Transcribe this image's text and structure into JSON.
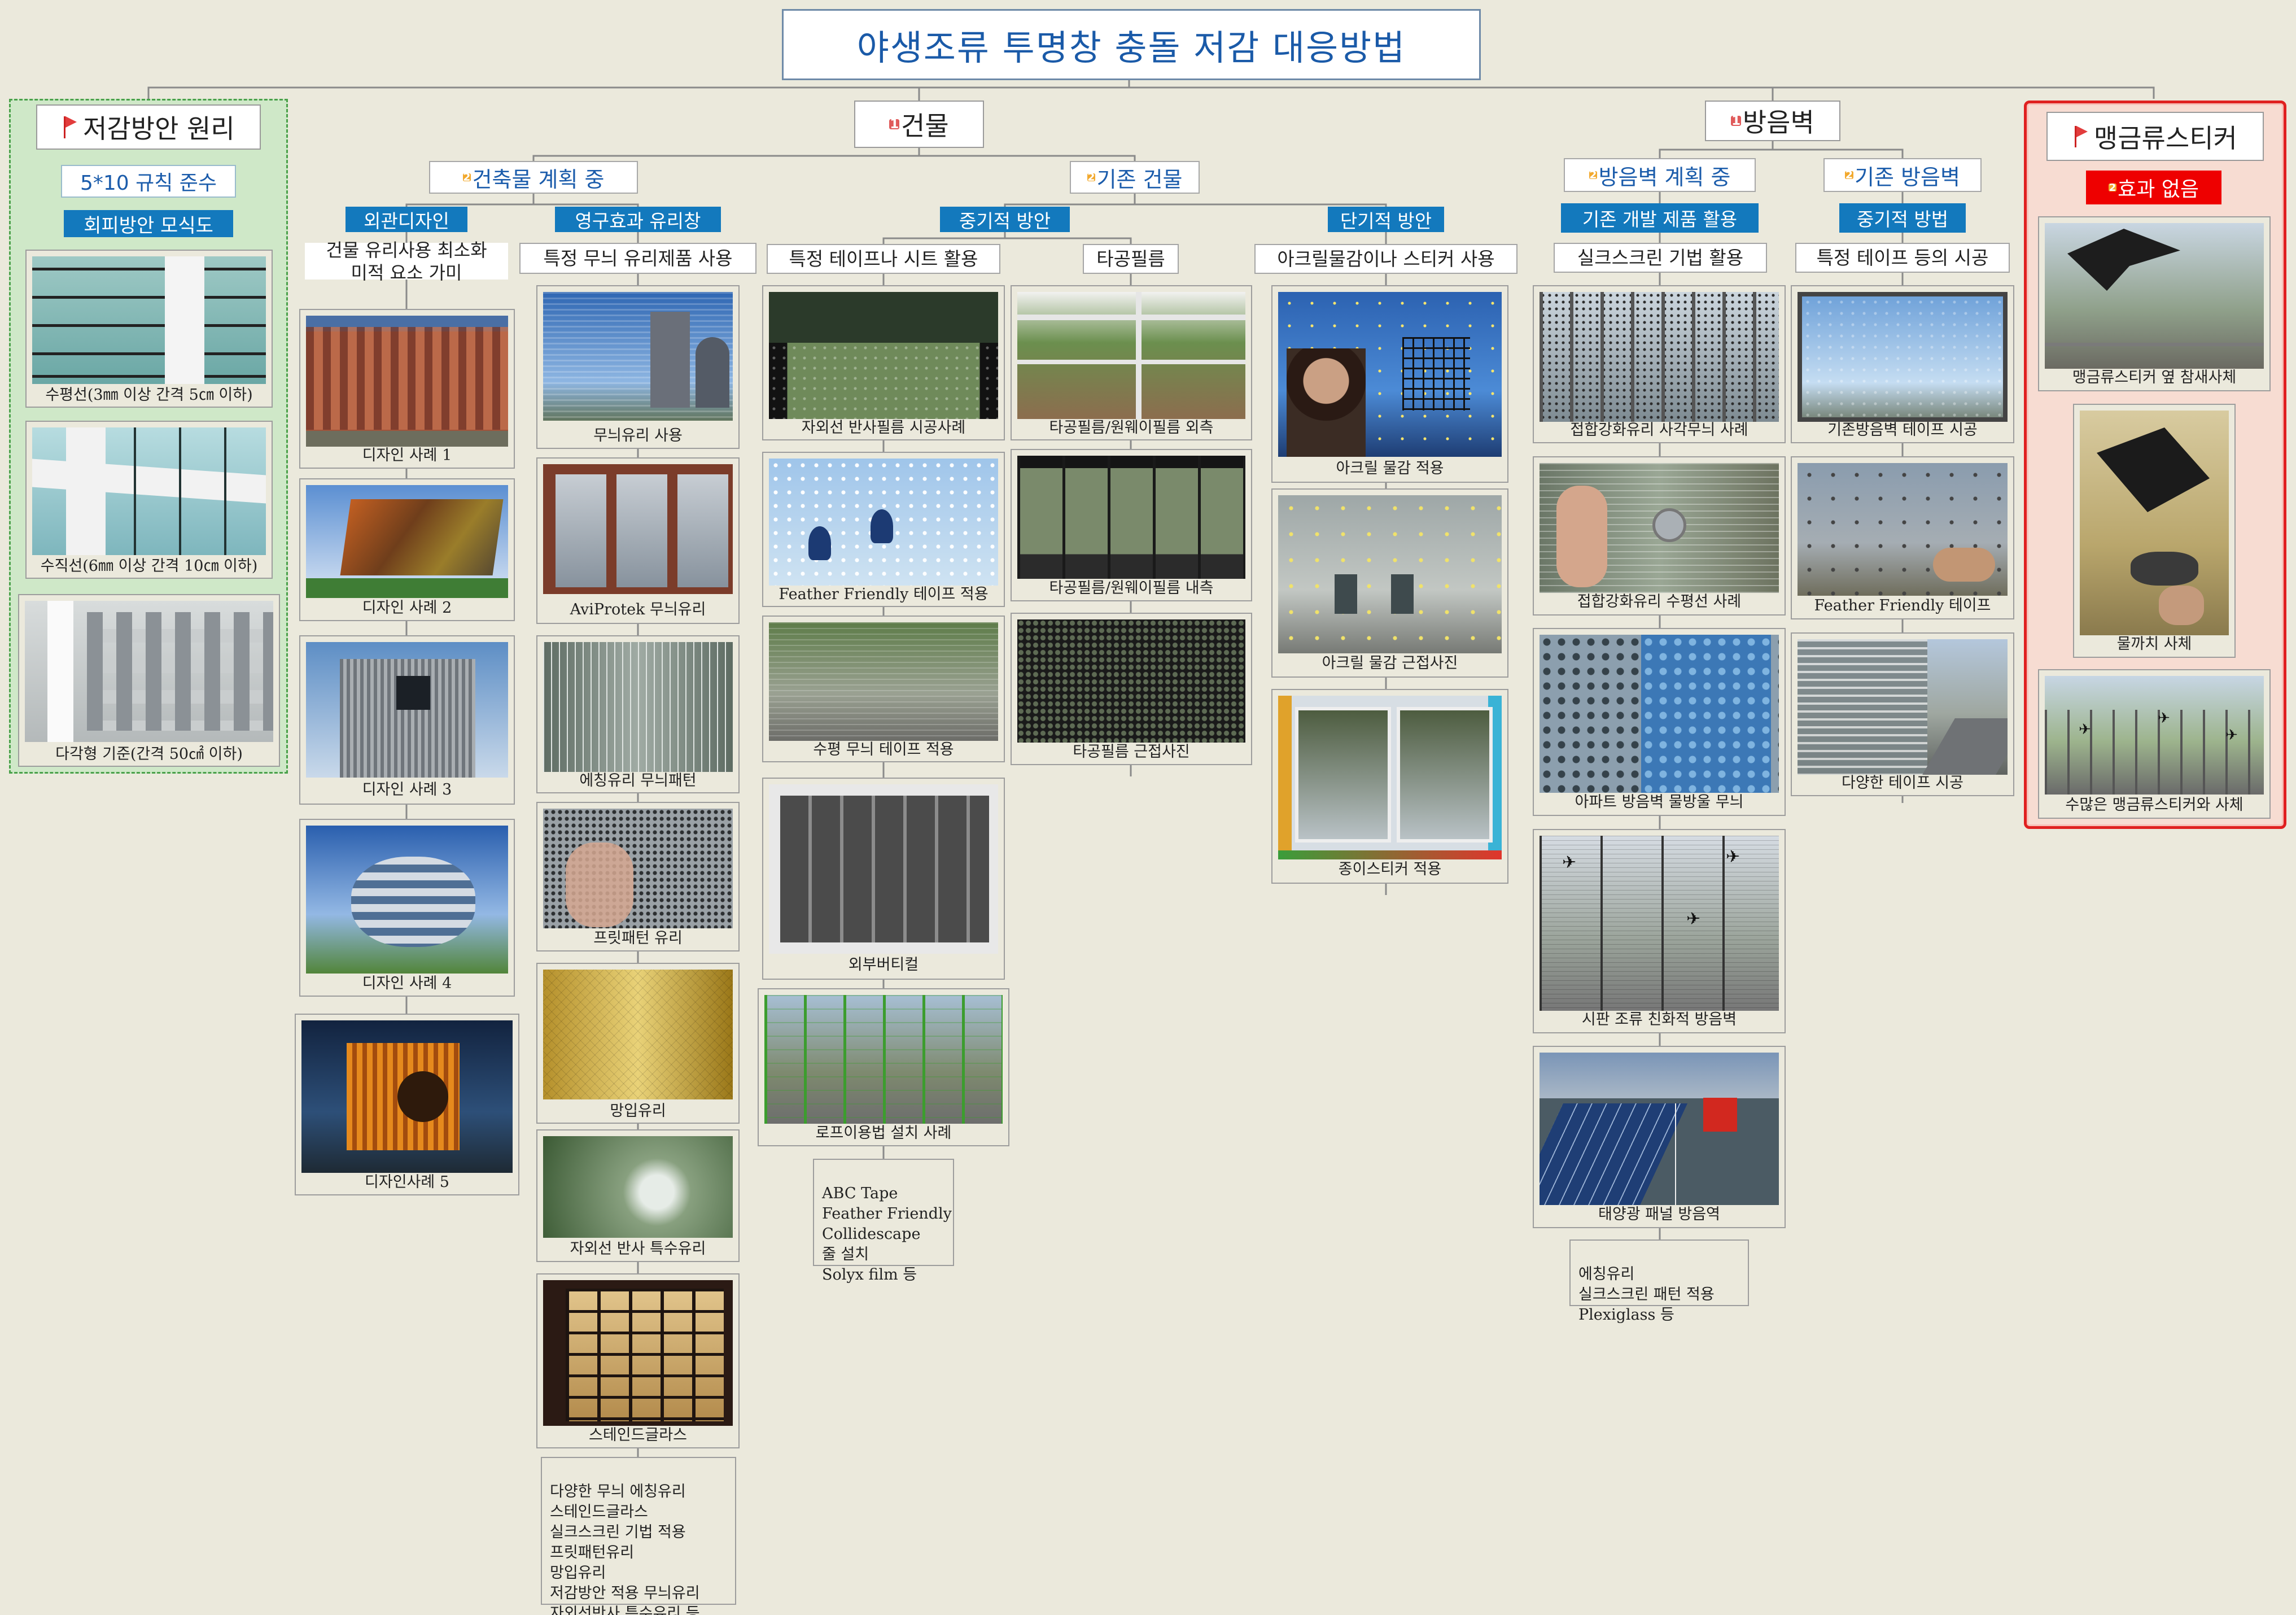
{
  "title": "야생조류 투명창 충돌 저감 대응방법",
  "left": {
    "title": "저감방안 원리",
    "rule": "5*10 규칙 준수",
    "diagram_label": "회피방안 모식도",
    "images": [
      "수평선(3㎜ 이상 간격 5㎝ 이하)",
      "수직선(6㎜ 이상 간격 10㎝ 이하)",
      "다각형 기준(간격 50㎠ 이하)"
    ]
  },
  "building": {
    "badge": "1",
    "title": "건물",
    "planning": {
      "badge": "2",
      "title": "건축물 계획 중",
      "exterior": {
        "label": "외관디자인",
        "desc": [
          "건물 유리사용 최소화",
          "미적 요소 가미"
        ],
        "images": [
          "디자인 사례 1",
          "디자인 사례 2",
          "디자인 사례 3",
          "디자인 사례 4",
          "디자인사례 5"
        ]
      },
      "permanent": {
        "label": "영구효과 유리창",
        "desc": "특정 무늬 유리제품 사용",
        "images": [
          "무늬유리 사용",
          "AviProtek 무늬유리",
          "에칭유리 무늬패턴",
          "프릿패턴 유리",
          "망입유리",
          "자외선 반사 특수유리",
          "스테인드글라스"
        ],
        "notes": [
          "다양한 무늬 에칭유리",
          "스테인드글라스",
          "실크스크린 기법 적용",
          "프릿패턴유리",
          "망입유리",
          "저감방안 적용 무늬유리",
          "자외선반사 특수유리 등"
        ]
      }
    },
    "existing": {
      "badge": "2",
      "title": "기존 건물",
      "midterm": {
        "label": "중기적 방안",
        "tape": {
          "desc": "특정 테이프나 시트 활용",
          "images": [
            "자외선 반사필름 시공사례",
            "Feather Friendly 테이프 적용",
            "수평 무늬 테이프 적용",
            "외부버티컬",
            "로프이용법 설치 사례"
          ],
          "notes": [
            "ABC Tape",
            "Feather Friendly",
            "Collidescape",
            "줄 설치",
            "Solyx film 등"
          ]
        },
        "film": {
          "desc": "타공필름",
          "images": [
            "타공필름/원웨이필름 외측",
            "타공필름/원웨이필름 내측",
            "타공필름 근접사진"
          ]
        }
      },
      "shortterm": {
        "label": "단기적 방안",
        "desc": "아크릴물감이나 스티커 사용",
        "images": [
          "아크릴 물감 적용",
          "아크릴 물감 근접사진",
          "종이스티커 적용"
        ]
      }
    }
  },
  "wall": {
    "badge": "1",
    "title": "방음벽",
    "planning": {
      "badge": "2",
      "title": "방음벽 계획 중",
      "label": "기존 개발 제품 활용",
      "desc": "실크스크린 기법 활용",
      "images": [
        "접합강화유리 사각무늬 사례",
        "접합강화유리 수평선 사례",
        "아파트 방음벽 물방울 무늬",
        "시판 조류 친화적 방음벽",
        "태양광 패널 방음역"
      ],
      "notes": [
        "에칭유리",
        "실크스크린 패턴 적용",
        "Plexiglass 등"
      ]
    },
    "existing": {
      "badge": "2",
      "title": "기존 방음벽",
      "label": "중기적 방법",
      "desc": "특정 테이프 등의 시공",
      "images": [
        "기존방음벽 테이프 시공",
        "Feather Friendly 테이프",
        "다양한 테이프 시공"
      ]
    }
  },
  "sticker": {
    "title": "맹금류스티커",
    "badge": "2",
    "label": "효과 없음",
    "images": [
      "맹금류스티커 옆 참새사체",
      "물까치 사체",
      "수많은 맹금류스티커와 사체"
    ]
  },
  "colors": {
    "background": "#ebe9dc",
    "blue_label": "#1379bd",
    "title_blue": "#1a5aa8",
    "green_panel": "#cfe8c8",
    "red_panel": "#f7dcd2",
    "red_label": "#ee0000"
  },
  "icons": [
    "flag-icon",
    "priority-badge-1",
    "priority-badge-2"
  ]
}
